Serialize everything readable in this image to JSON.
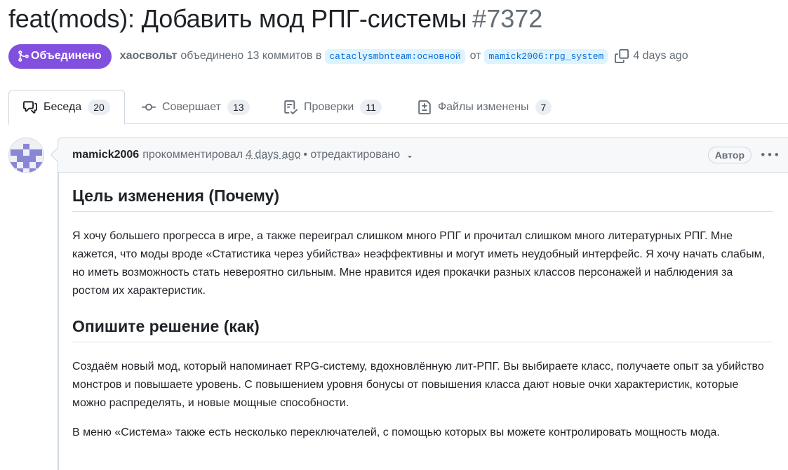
{
  "pull_request": {
    "title": "feat(mods): Добавить мод РПГ-системы",
    "number": "#7372",
    "state": "Объединено",
    "state_color": "#8250df",
    "merger": "хаосвольт",
    "merge_text": "объединено 13 коммитов в",
    "base_branch": "cataclysmbnteam:основной",
    "from_text": "от",
    "head_branch": "mamick2006:rpg_system",
    "time_ago": "4 days ago"
  },
  "tabs": [
    {
      "label": "Беседа",
      "count": "20",
      "icon": "comment-discussion-icon"
    },
    {
      "label": "Совершает",
      "count": "13",
      "icon": "git-commit-icon"
    },
    {
      "label": "Проверки",
      "count": "11",
      "icon": "checklist-icon"
    },
    {
      "label": "Файлы изменены",
      "count": "7",
      "icon": "file-diff-icon"
    }
  ],
  "comment": {
    "author": "mamick2006",
    "action": "прокомментировал",
    "timestamp": "4 days ago",
    "edited": "• отредактировано",
    "role": "Автор",
    "heading1": "Цель изменения (Почему)",
    "paragraph1": "Я хочу большего прогресса в игре, а также переиграл слишком много РПГ и прочитал слишком много литературных РПГ. Мне кажется, что моды вроде «Статистика через убийства» неэффективны и могут иметь неудобный интерфейс. Я хочу начать слабым, но иметь возможность стать невероятно сильным. Мне нравится идея прокачки разных классов персонажей и наблюдения за ростом их характеристик.",
    "heading2": "Опишите решение (как)",
    "paragraph2": "Создаём новый мод, который напоминает RPG-систему, вдохновлённую лит-РПГ. Вы выбираете класс, получаете опыт за убийство монстров и повышаете уровень. С повышением уровня бонусы от повышения класса дают новые очки характеристик, которые можно распределять, и новые мощные способности.",
    "paragraph3": "В меню «Система» также есть несколько переключателей, с помощью которых вы можете контролировать мощность мода."
  }
}
